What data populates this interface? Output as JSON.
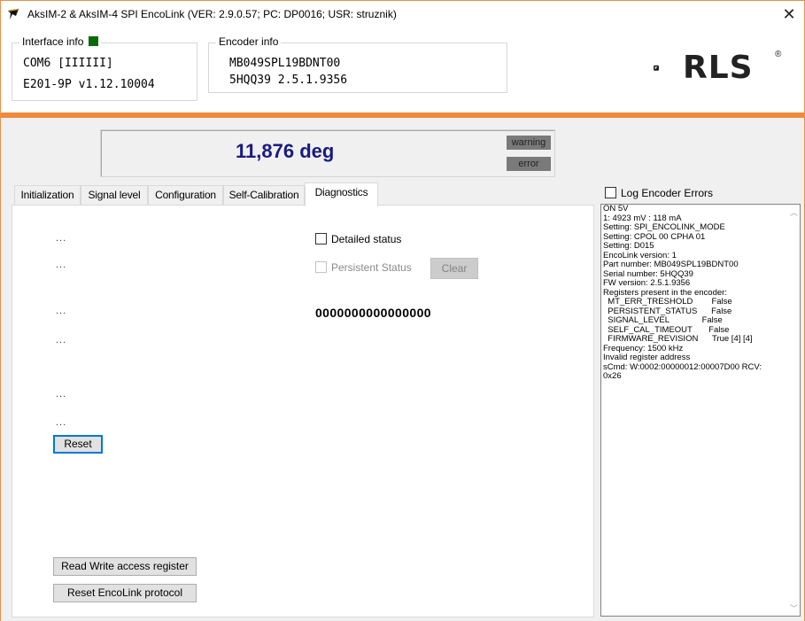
{
  "window": {
    "title": "AksIM-2 & AksIM-4 SPI EncoLink (VER: 2.9.0.57; PC: DP0016; USR: struznik)",
    "close_glyph": "✕"
  },
  "interface_info": {
    "legend": "Interface info",
    "port": "COM6  [IIIIII]",
    "device": "E201-9P v1.12.10004",
    "led_color": "#0b6a0b"
  },
  "encoder_info": {
    "legend": "Encoder info",
    "part_number": "MB049SPL19BDNT00",
    "serial_fw": "5HQQ39   2.5.1.9356"
  },
  "logo": {
    "text": "RLS",
    "reg": "®"
  },
  "accent_color": "#f08a3a",
  "position": {
    "value": "11,876 deg",
    "warning_label": "warning",
    "error_label": "error"
  },
  "tabs": [
    {
      "label": "Initialization",
      "active": false
    },
    {
      "label": "Signal level",
      "active": false
    },
    {
      "label": "Configuration",
      "active": false
    },
    {
      "label": "Self-Calibration",
      "active": false
    },
    {
      "label": "Diagnostics",
      "active": true
    }
  ],
  "diagnostics": {
    "ellipsis": [
      "...",
      "...",
      "...",
      "...",
      "...",
      "..."
    ],
    "reset_label": "Reset",
    "detailed_status_label": "Detailed status",
    "persistent_status_label": "Persistent Status",
    "clear_label": "Clear",
    "status_bits": "0000000000000000",
    "read_write_label": "Read Write access register",
    "reset_encolink_label": "Reset EncoLink protocol"
  },
  "log": {
    "checkbox_label": "Log Encoder Errors",
    "lines": [
      "ON 5V",
      "1: 4923 mV : 118 mA",
      "Setting: SPI_ENCOLINK_MODE",
      "Setting: CPOL 00 CPHA 01",
      "Setting: D015",
      "EncoLink version: 1",
      "Part number: MB049SPL19BDNT00",
      "Serial number: 5HQQ39",
      "FW version: 2.5.1.9356",
      "Registers present in the encoder:",
      "  MT_ERR_TRESHOLD        False",
      "  PERSISTENT_STATUS      False",
      "  SIGNAL_LEVEL              False",
      "  SELF_CAL_TIMEOUT       False",
      "  FIRMWARE_REVISION      True [4] [4]",
      "Frequency: 1500 kHz",
      "Invalid register address",
      "sCmd: W:0002:00000012:00007D00 RCV:",
      "0x26"
    ]
  }
}
